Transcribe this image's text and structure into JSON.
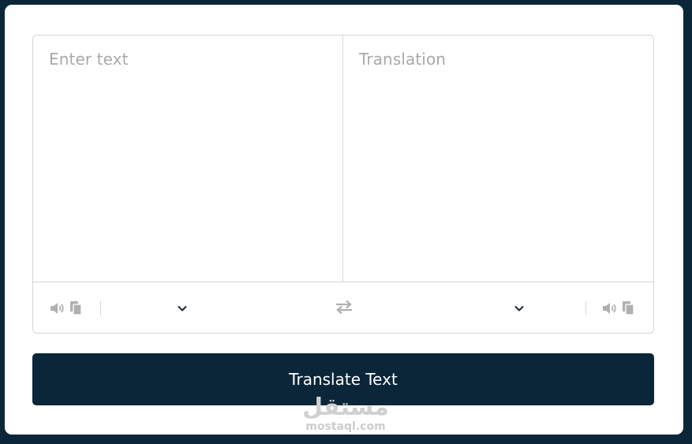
{
  "input": {
    "placeholder": "Enter text"
  },
  "output": {
    "placeholder": "Translation"
  },
  "controls": {
    "from_language": "",
    "to_language": "",
    "icons": {
      "speak": "speaker-icon",
      "copy": "copy-icon",
      "dropdown": "chevron-down-icon",
      "swap": "swap-arrows-icon"
    }
  },
  "translate_button": {
    "label": "Translate Text"
  },
  "watermark": {
    "arabic": "مستقل",
    "latin": "mostaql.com"
  },
  "colors": {
    "background": "#0b2639",
    "card": "#ffffff",
    "border": "#d6d6d6",
    "placeholder": "#a9a9a9",
    "icon": "#b0b0b0",
    "button": "#0b2639",
    "button_text": "#ffffff"
  }
}
